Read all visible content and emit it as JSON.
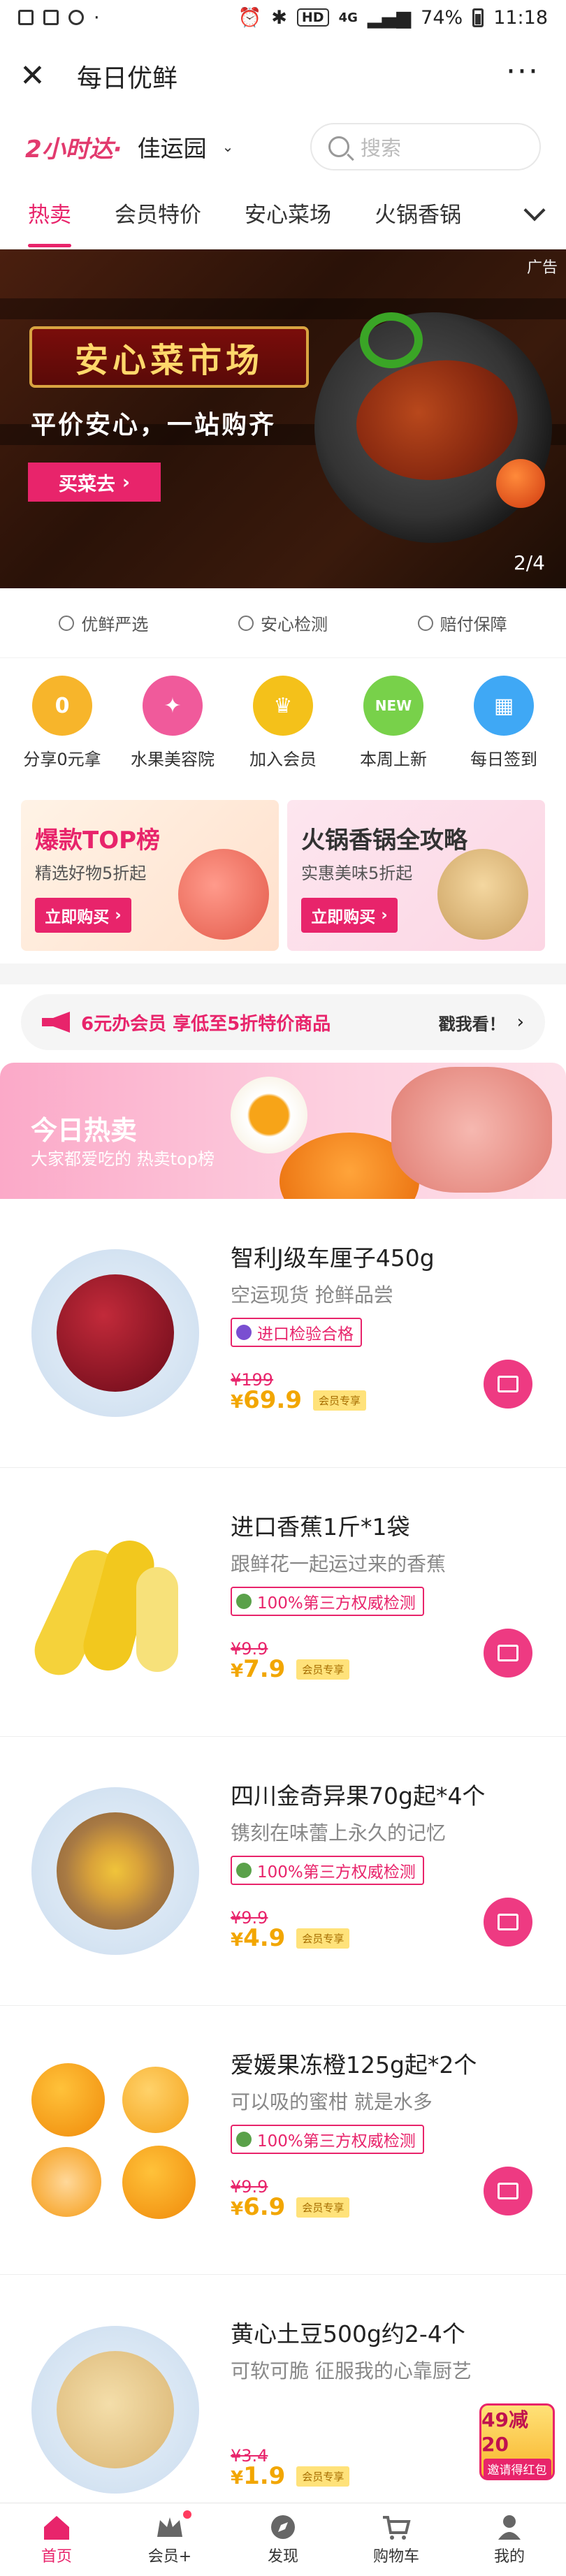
{
  "status_bar": {
    "time": "11:18",
    "battery": "74%",
    "hd": "HD",
    "network": "4G"
  },
  "title_bar": {
    "title": "每日优鲜",
    "close_icon": "close-icon",
    "more_icon": "more-icon"
  },
  "location": {
    "brand": "2小时达·",
    "community": "佳运园",
    "search_placeholder": "搜索"
  },
  "tabs": [
    {
      "label": "热卖",
      "active": true
    },
    {
      "label": "会员特价",
      "active": false
    },
    {
      "label": "安心菜场",
      "active": false
    },
    {
      "label": "火锅香锅",
      "active": false
    }
  ],
  "banner": {
    "ad_label": "广告",
    "title": "安心菜市场",
    "slogan": "平价安心，一站购齐",
    "button": "买菜去",
    "pager": "2/4"
  },
  "guarantees": [
    "优鲜严选",
    "安心检测",
    "赔付保障"
  ],
  "quick_links": [
    {
      "label": "分享0元拿",
      "icon": "gift-icon",
      "color": "#f7b52b"
    },
    {
      "label": "水果美容院",
      "icon": "compass-icon",
      "color": "#f05a9b"
    },
    {
      "label": "加入会员",
      "icon": "vip-crown-icon",
      "color": "#f4c11a"
    },
    {
      "label": "本周上新",
      "icon": "new-badge-icon",
      "color": "#78d14a"
    },
    {
      "label": "每日签到",
      "icon": "calendar-icon",
      "color": "#3fa8f5"
    }
  ],
  "promos": [
    {
      "title": "爆款TOP榜",
      "subtitle": "精选好物5折起",
      "button": "立即购买"
    },
    {
      "title": "火锅香锅全攻略",
      "subtitle": "实惠美味5折起",
      "button": "立即购买"
    }
  ],
  "member_bar": {
    "text": "6元办会员 享低至5折特价商品",
    "cta": "戳我看！"
  },
  "hot_section": {
    "title": "今日热卖",
    "subtitle": "大家都爱吃的 热卖top榜"
  },
  "products": [
    {
      "name": "智利J级车厘子450g",
      "desc": "空运现货 抢鲜品尝",
      "tag": "进口检验合格",
      "original_price": "¥199",
      "price": "69.9",
      "member_badge": "会员专享",
      "image": "cherries",
      "color": "#8a1020"
    },
    {
      "name": "进口香蕉1斤*1袋",
      "desc": "跟鲜花一起运过来的香蕉",
      "tag": "100%第三方权威检测",
      "original_price": "¥9.9",
      "price": "7.9",
      "member_badge": "会员专享",
      "image": "bananas",
      "color": "#f5d23a"
    },
    {
      "name": "四川金奇异果70g起*4个",
      "desc": "镌刻在味蕾上永久的记忆",
      "tag": "100%第三方权威检测",
      "original_price": "¥9.9",
      "price": "4.9",
      "member_badge": "会员专享",
      "image": "kiwis",
      "color": "#b88a4a"
    },
    {
      "name": "爱媛果冻橙125g起*2个",
      "desc": "可以吸的蜜柑 就是水多",
      "tag": "100%第三方权威检测",
      "original_price": "¥9.9",
      "price": "6.9",
      "member_badge": "会员专享",
      "image": "oranges",
      "color": "#f59a12"
    },
    {
      "name": "黄心土豆500g约2-4个",
      "desc": "可软可脆 征服我的心靠厨艺",
      "tag": "",
      "original_price": "¥3.4",
      "price": "1.9",
      "member_badge": "会员专享",
      "image": "potatoes",
      "color": "#e8c98a"
    }
  ],
  "coupon": {
    "amount": "49减20",
    "label": "邀请得红包"
  },
  "bottom_nav": [
    {
      "label": "首页",
      "icon": "home-icon",
      "active": true
    },
    {
      "label": "会员+",
      "icon": "crown-icon",
      "active": false
    },
    {
      "label": "发现",
      "icon": "discover-icon",
      "active": false
    },
    {
      "label": "购物车",
      "icon": "cart-icon",
      "active": false
    },
    {
      "label": "我的",
      "icon": "profile-icon",
      "active": false
    }
  ]
}
